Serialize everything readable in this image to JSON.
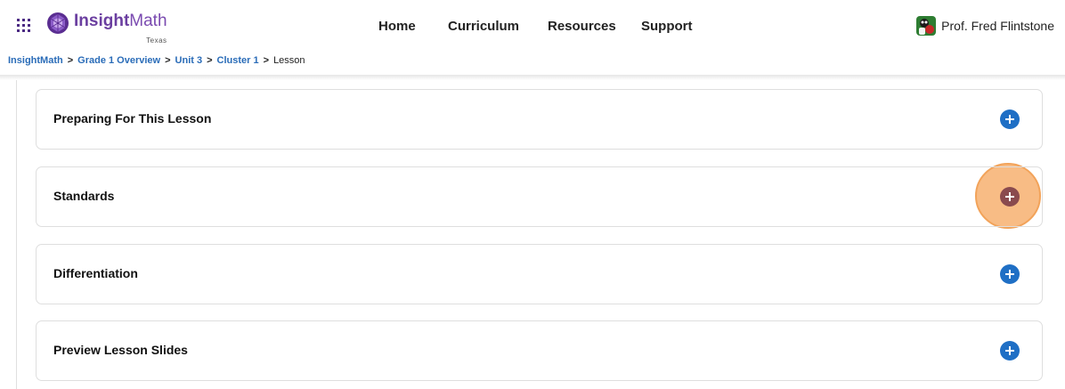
{
  "header": {
    "logo": {
      "text_bold": "Insight",
      "text_thin": "Math",
      "sub": "Texas"
    },
    "nav": [
      {
        "label": "Home"
      },
      {
        "label": "Curriculum"
      },
      {
        "label": "Resources"
      },
      {
        "label": "Support"
      }
    ],
    "user": {
      "name": "Prof. Fred Flintstone"
    }
  },
  "breadcrumb": {
    "items": [
      "InsightMath",
      "Grade 1 Overview",
      "Unit 3",
      "Cluster 1"
    ],
    "separator": ">",
    "current": "Lesson"
  },
  "panels": [
    {
      "title": "Preparing For This Lesson",
      "icon": "plus-circle-icon"
    },
    {
      "title": "Standards",
      "icon": "plus-circle-icon",
      "highlighted": true
    },
    {
      "title": "Differentiation",
      "icon": "plus-circle-icon"
    },
    {
      "title": "Preview Lesson Slides",
      "icon": "plus-circle-icon"
    }
  ],
  "colors": {
    "brand": "#6b3fa0",
    "link": "#2a6cb8",
    "plus_button": "#1f6fc5",
    "highlight": "#f7b070"
  }
}
